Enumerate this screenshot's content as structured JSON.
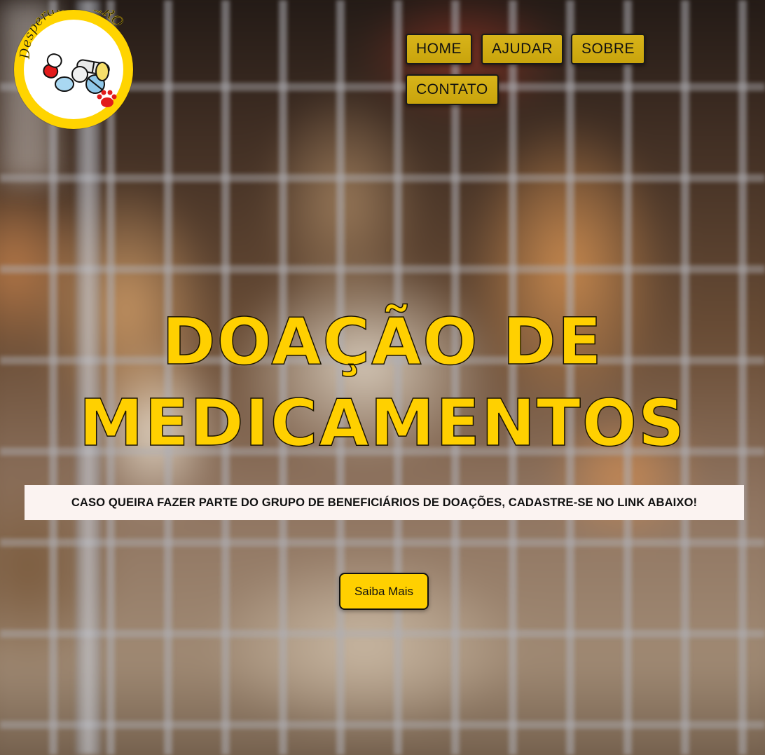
{
  "logo": {
    "text": "Desperdício ZERO"
  },
  "nav": {
    "items": [
      {
        "label": "HOME"
      },
      {
        "label": "AJUDAR"
      },
      {
        "label": "SOBRE"
      },
      {
        "label": "CONTATO"
      }
    ]
  },
  "hero": {
    "title_line1": "DOAÇÃO DE",
    "title_line2": "MEDICAMENTOS"
  },
  "banner": {
    "text": "CASO QUEIRA FAZER PARTE DO GRUPO DE BENEFICIÁRIOS DE DOAÇÕES, CADASTRE-SE NO LINK ABAIXO!"
  },
  "cta": {
    "label": "Saiba Mais"
  },
  "colors": {
    "accent": "#ffd000",
    "nav_button": "#c9a40c",
    "banner_bg": "#fbf3f1"
  }
}
